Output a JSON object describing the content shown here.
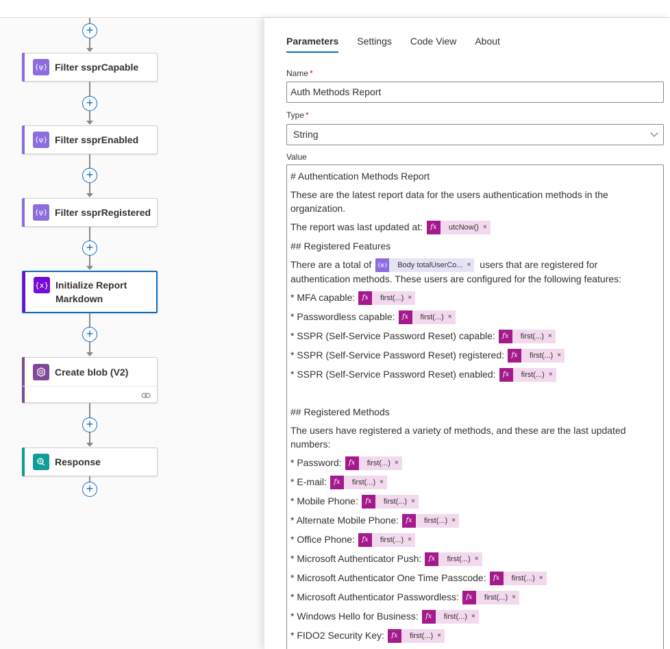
{
  "flow": {
    "steps": [
      {
        "title": "Filter ssprCapable",
        "icon": "filter-array-icon",
        "color": "#8c6cde"
      },
      {
        "title": "Filter ssprEnabled",
        "icon": "filter-array-icon",
        "color": "#8c6cde"
      },
      {
        "title": "Filter ssprRegistered",
        "icon": "filter-array-icon",
        "color": "#8c6cde"
      },
      {
        "title_line1": "Initialize Report",
        "title_line2": "Markdown",
        "icon": "variable-icon",
        "color": "#770bd6"
      },
      {
        "title": "Create blob (V2)",
        "icon": "azure-blob-icon",
        "color": "#804998"
      },
      {
        "title": "Response",
        "icon": "response-icon",
        "color": "#0f9d9a"
      }
    ]
  },
  "panel": {
    "tabs": [
      "Parameters",
      "Settings",
      "Code View",
      "About"
    ],
    "active_tab": "Parameters",
    "name_label": "Name",
    "name_value": "Auth Methods Report",
    "type_label": "Type",
    "type_value": "String",
    "value_label": "Value",
    "required_mark": "*"
  },
  "value": {
    "l1": "# Authentication Methods Report",
    "l2": "These are the latest report data for the users authentication methods in the organization.",
    "l3": "The report was last updated at:",
    "l3_token": "utcNow()",
    "l4": "## Registered Features",
    "l5a": "There are a total of",
    "l5_token": "Body totalUserCo...",
    "l5b": "users that are registered for",
    "l6": "authentication methods. These users are configured for the following features:",
    "features": [
      "* MFA capable:",
      "* Passwordless capable:",
      "* SSPR (Self-Service Password Reset) capable:",
      "* SSPR (Self-Service Password Reset) registered:",
      "* SSPR (Self-Service Password Reset) enabled:"
    ],
    "l_methods_head": "## Registered Methods",
    "l_methods_intro": "The users have registered a variety of methods, and these are the last updated numbers:",
    "methods": [
      "* Password:",
      "* E-mail:",
      "* Mobile Phone:",
      "* Alternate Mobile Phone:",
      "* Office Phone:",
      "* Microsoft Authenticator Push:",
      "* Microsoft Authenticator  One Time Passcode:",
      "* Microsoft Authenticator Passwordless:",
      "* Windows Hello for Business:",
      "* FIDO2 Security Key:"
    ],
    "first_token": "first(...)",
    "fx_glyph": "fx",
    "remove_glyph": "×",
    "body_glyph": "{ψ}"
  },
  "colors": {
    "accent": "#0f6cbd",
    "fx_token": "#a4198b",
    "body_token": "#8c6cde"
  }
}
